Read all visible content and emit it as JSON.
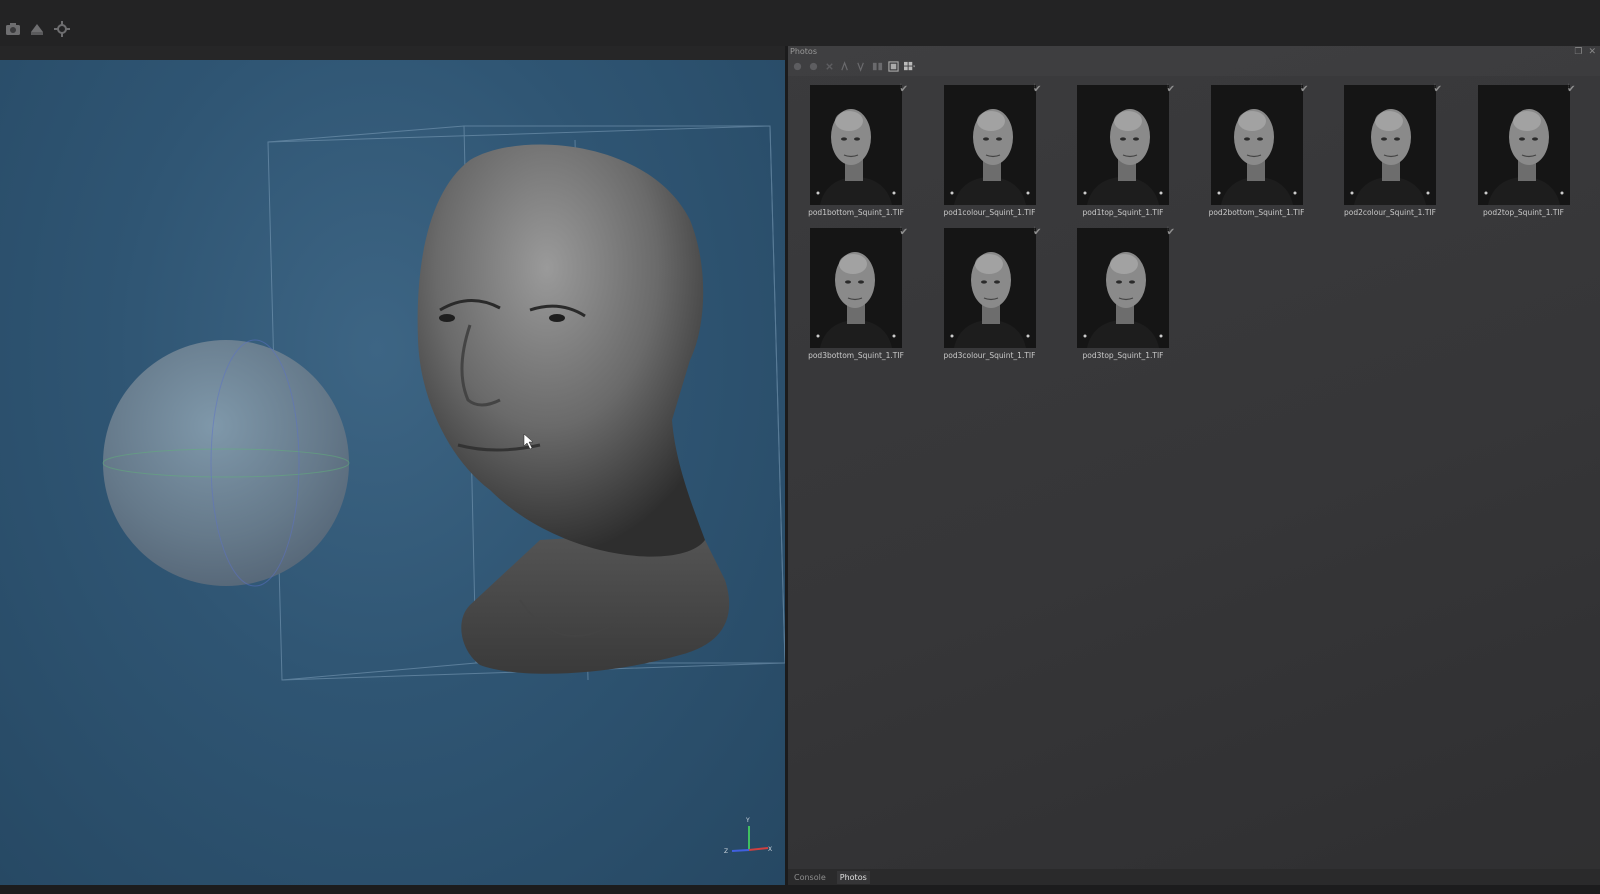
{
  "toolbar": {
    "icons": [
      "camera-icon",
      "layers-icon",
      "target-icon"
    ]
  },
  "photos_panel": {
    "title": "Photos",
    "toolbar_icons": [
      "add-icon",
      "remove-icon",
      "close-icon",
      "sort-icon",
      "sort-alt-icon",
      "group-icon",
      "single-view-icon",
      "grid-view-icon"
    ],
    "photos": [
      {
        "name": "pod1bottom_Squint_1.TIF",
        "checked": true
      },
      {
        "name": "pod1colour_Squint_1.TIF",
        "checked": true
      },
      {
        "name": "pod1top_Squint_1.TIF",
        "checked": true
      },
      {
        "name": "pod2bottom_Squint_1.TIF",
        "checked": true
      },
      {
        "name": "pod2colour_Squint_1.TIF",
        "checked": true
      },
      {
        "name": "pod2top_Squint_1.TIF",
        "checked": true
      },
      {
        "name": "pod3bottom_Squint_1.TIF",
        "checked": true
      },
      {
        "name": "pod3colour_Squint_1.TIF",
        "checked": true
      },
      {
        "name": "pod3top_Squint_1.TIF",
        "checked": true
      }
    ]
  },
  "bottom_tabs": [
    {
      "label": "Console",
      "active": false
    },
    {
      "label": "Photos",
      "active": true
    }
  ],
  "axis_gizmo": {
    "y": "Y",
    "z": "Z",
    "x": "X"
  },
  "colors": {
    "viewport_bg": "#2f5573",
    "panel_bg": "#3c3c3e",
    "axis_x": "#d04040",
    "axis_y": "#40c060",
    "axis_z": "#4060e0"
  }
}
